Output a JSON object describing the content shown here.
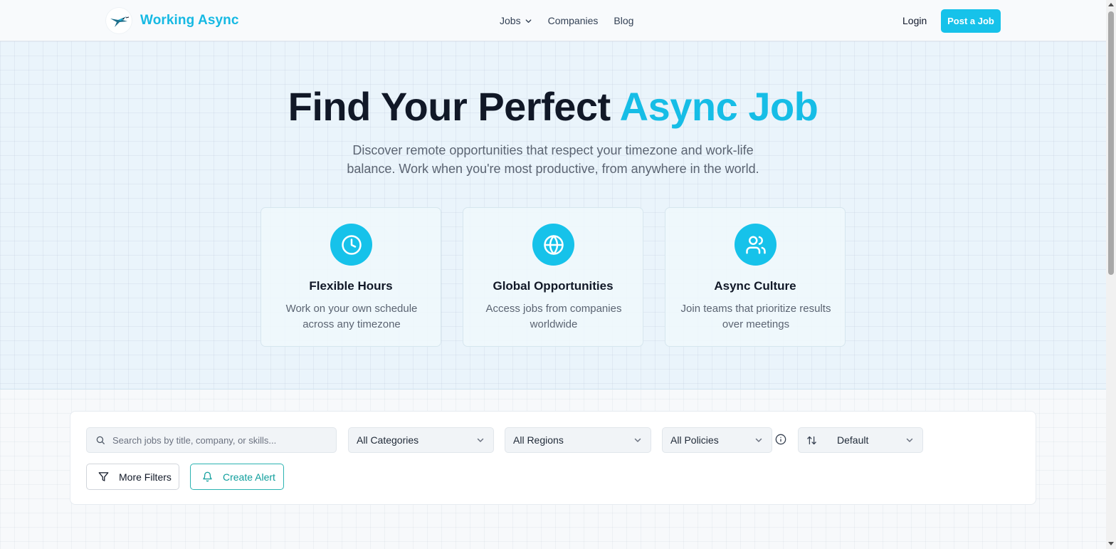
{
  "header": {
    "brand": "Working Async",
    "nav": [
      {
        "label": "Jobs",
        "has_dropdown": true
      },
      {
        "label": "Companies"
      },
      {
        "label": "Blog"
      }
    ],
    "login_label": "Login",
    "post_job_label": "Post a Job"
  },
  "hero": {
    "title_main": "Find Your Perfect",
    "title_accent": "Async Job",
    "subtitle": "Discover remote opportunities that respect your timezone and work-life balance. Work when you're most productive, from anywhere in the world."
  },
  "features": [
    {
      "icon": "clock-icon",
      "title": "Flexible Hours",
      "description": "Work on your own schedule across any timezone"
    },
    {
      "icon": "globe-icon",
      "title": "Global Opportunities",
      "description": "Access jobs from companies worldwide"
    },
    {
      "icon": "users-icon",
      "title": "Async Culture",
      "description": "Join teams that prioritize results over meetings"
    }
  ],
  "filters": {
    "search_placeholder": "Search jobs by title, company, or skills...",
    "category": "All Categories",
    "region": "All Regions",
    "policy": "All Policies",
    "sort": "Default",
    "more_filters_label": "More Filters",
    "create_alert_label": "Create Alert"
  },
  "colors": {
    "accent": "#16c2ea",
    "accent_text": "#16bde6",
    "alert_teal": "#0ea5a4"
  }
}
